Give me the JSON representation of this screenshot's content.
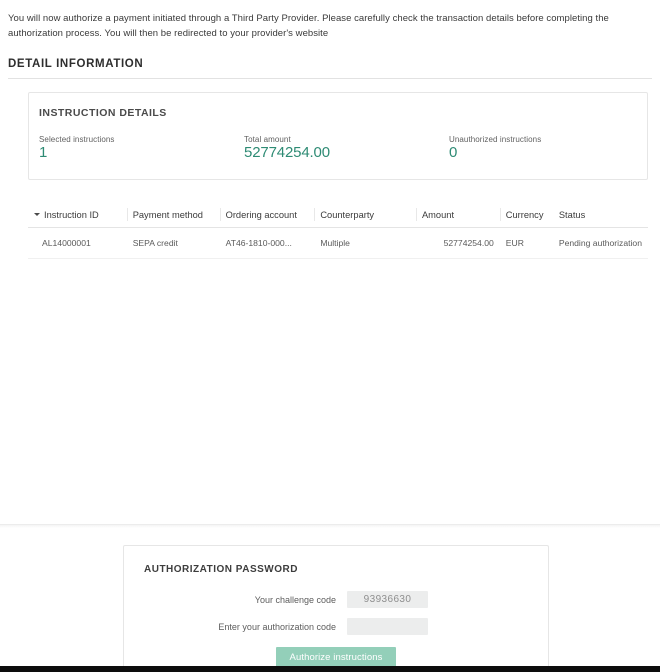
{
  "intro": {
    "text": "You will now authorize a payment initiated through a Third Party Provider. Please carefully check the transaction details before completing the authorization process. You will then be redirected to your provider's website"
  },
  "section": {
    "heading": "DETAIL INFORMATION"
  },
  "instruction_details": {
    "title": "INSTRUCTION DETAILS",
    "metrics": [
      {
        "label": "Selected instructions",
        "value": "1"
      },
      {
        "label": "Total amount",
        "value": "52774254.00"
      },
      {
        "label": "Unauthorized instructions",
        "value": "0"
      }
    ]
  },
  "table": {
    "sort_icon": "caret-down-icon",
    "columns": [
      "Instruction ID",
      "Payment method",
      "Ordering account",
      "Counterparty",
      "Amount",
      "Currency",
      "Status"
    ],
    "rows": [
      {
        "instruction_id": "AL14000001",
        "payment_method": "SEPA credit",
        "ordering_account": "AT46-1810-000...",
        "counterparty": "Multiple",
        "amount": "52774254.00",
        "currency": "EUR",
        "status": "Pending authorization"
      }
    ]
  },
  "authorization": {
    "title": "AUTHORIZATION PASSWORD",
    "challenge_label": "Your challenge code",
    "challenge_value": "93936630",
    "auth_code_label": "Enter your authorization code",
    "auth_code_value": "",
    "auth_code_placeholder": "",
    "submit_label": "Authorize instructions"
  },
  "colors": {
    "accent_teal": "#2e8b74",
    "button_green": "#93cfb9",
    "field_grey": "#eceded"
  }
}
